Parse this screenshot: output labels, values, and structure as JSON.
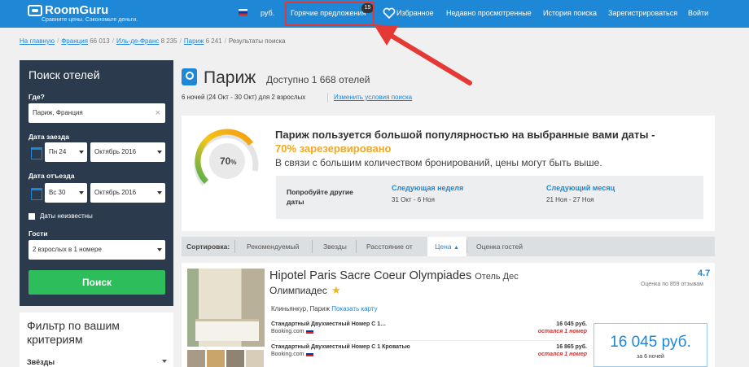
{
  "header": {
    "logo": "RoomGuru",
    "tagline": "Сравните цены. Сэкономьте деньги.",
    "currency": "руб.",
    "hot_deals": "Горячие предложения",
    "hot_count": "15",
    "favorites": "Избранное",
    "recent": "Недавно просмотренные",
    "history": "История поиска",
    "register": "Зарегистрироваться",
    "login": "Войти"
  },
  "breadcrumb": {
    "home": "На главную",
    "country": "Франция",
    "country_n": "66 013",
    "region": "Иль-де-Франс",
    "region_n": "8 235",
    "city": "Париж",
    "city_n": "6 241",
    "current": "Результаты поиска"
  },
  "search": {
    "title": "Поиск отелей",
    "where_label": "Где?",
    "where_value": "Париж, Франция",
    "checkin_label": "Дата заезда",
    "checkin_day": "Пн 24",
    "checkin_month": "Октябрь 2016",
    "checkout_label": "Дата отъезда",
    "checkout_day": "Вс 30",
    "checkout_month": "Октябрь 2016",
    "unknown_dates": "Даты неизвестны",
    "guests_label": "Гости",
    "guests_value": "2 взрослых в 1 номере",
    "submit": "Поиск"
  },
  "filter": {
    "title": "Фильтр по вашим критериям",
    "stars": "Звёзды"
  },
  "results": {
    "city": "Париж",
    "available": "Доступно 1 668 отелей",
    "dates": "6 ночей (24 Окт - 30 Окт) для 2 взрослых",
    "change": "Изменить условия поиска"
  },
  "popularity": {
    "percent": "70",
    "percent_sign": "%",
    "title": "Париж пользуется большой популярностью на выбранные вами даты -",
    "booked": "70% зарезервировано",
    "sub": "В связи с большим количеством бронирований, цены могут быть выше.",
    "try_label": "Попробуйте другие даты",
    "next_week": "Следующая неделя",
    "next_week_dates": "31 Окт - 6 Ноя",
    "next_month": "Следующий месяц",
    "next_month_dates": "21 Ноя - 27 Ноя"
  },
  "sort": {
    "label": "Сортировка:",
    "recommended": "Рекомендуемый",
    "stars": "Звезды",
    "distance": "Расстояние от",
    "price": "Цена",
    "rating": "Оценка гостей"
  },
  "hotel": {
    "name": "Hipotel Paris Sacre Coeur Olympiades",
    "type": "Отель Дес",
    "name2": "Олимпиадес",
    "rating": "4.7",
    "reviews": "Оценка по 859 отзывам",
    "location": "Клиньянкур, Париж",
    "show_map": "Показать карту",
    "offers": [
      {
        "room": "Стандартный Двухместный Номер С 1…",
        "site": "Booking.com",
        "price": "16 045 руб.",
        "left": "остался 1 номер"
      },
      {
        "room": "Стандартный Двухместный Номер С 1 Кроватью",
        "site": "Booking.com",
        "price": "16 865 руб.",
        "left": "остался 1 номер"
      }
    ],
    "best_price": "16 045 руб.",
    "per": "за 6 ночей"
  },
  "colors": {
    "brand": "#1e87d6",
    "search_panel": "#2b3a4d",
    "button": "#2ebd5b",
    "accent": "#f3a81f",
    "highlight": "#e53935"
  }
}
